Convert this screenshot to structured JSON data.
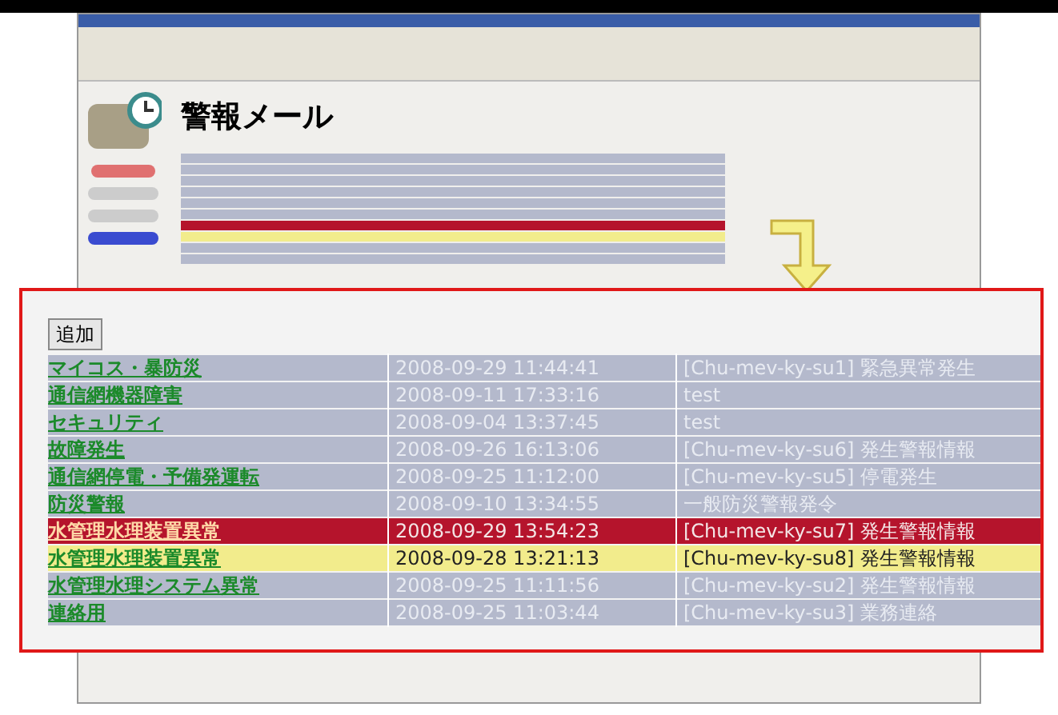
{
  "page_title": "警報メール",
  "add_button": "追加",
  "rows": [
    {
      "kind": "normal",
      "name": "マイコス・暴防災",
      "time": "2008-09-29 11:44:41",
      "subject": "[Chu-mev-ky-su1] 緊急異常発生"
    },
    {
      "kind": "normal",
      "name": "通信網機器障害",
      "time": "2008-09-11 17:33:16",
      "subject": "test"
    },
    {
      "kind": "normal",
      "name": "セキュリティ",
      "time": "2008-09-04 13:37:45",
      "subject": "test"
    },
    {
      "kind": "normal",
      "name": "故障発生",
      "time": "2008-09-26 16:13:06",
      "subject": "[Chu-mev-ky-su6] 発生警報情報"
    },
    {
      "kind": "normal",
      "name": "通信網停電・予備発運転",
      "time": "2008-09-25 11:12:00",
      "subject": "[Chu-mev-ky-su5] 停電発生"
    },
    {
      "kind": "normal",
      "name": "防災警報",
      "time": "2008-09-10 13:34:55",
      "subject": "一般防災警報発令"
    },
    {
      "kind": "alert",
      "name": "水管理水理装置異常",
      "time": "2008-09-29 13:54:23",
      "subject": "[Chu-mev-ky-su7] 発生警報情報"
    },
    {
      "kind": "warning",
      "name": "水管理水理装置異常",
      "time": "2008-09-28 13:21:13",
      "subject": "[Chu-mev-ky-su8] 発生警報情報"
    },
    {
      "kind": "normal",
      "name": "水管理水理システム異常",
      "time": "2008-09-25 11:11:56",
      "subject": "[Chu-mev-ky-su2] 発生警報情報"
    },
    {
      "kind": "normal",
      "name": "連絡用",
      "time": "2008-09-25 11:03:44",
      "subject": "[Chu-mev-ky-su3] 業務連絡"
    }
  ]
}
